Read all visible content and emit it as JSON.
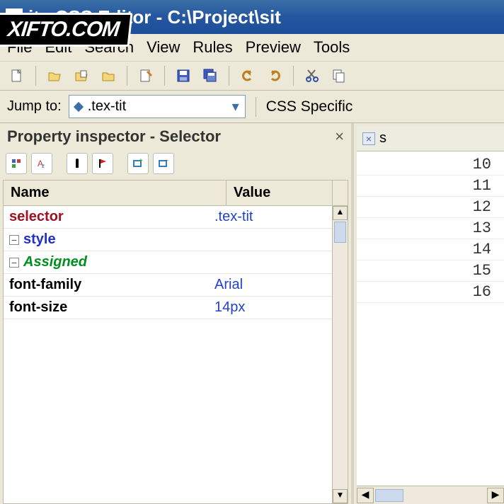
{
  "watermark": "XIFTO.COM",
  "window": {
    "title": "ite CSS Editor - C:\\Project\\sit"
  },
  "menu": {
    "items": [
      "File",
      "Edit",
      "Search",
      "View",
      "Rules",
      "Preview",
      "Tools"
    ]
  },
  "jump": {
    "label": "Jump to:",
    "value": ".tex-tit",
    "spec_label": "CSS Specific"
  },
  "inspector": {
    "title": "Property inspector - Selector",
    "columns": {
      "name": "Name",
      "value": "Value"
    },
    "rows": {
      "selector": {
        "label": "selector",
        "value": ".tex-tit"
      },
      "style": {
        "label": "style"
      },
      "assigned": {
        "label": "Assigned"
      },
      "font_family": {
        "label": "font-family",
        "value": "Arial"
      },
      "font_size": {
        "label": "font-size",
        "value": "14px"
      }
    }
  },
  "code": {
    "tab_label": "s",
    "lines": [
      "10",
      "11",
      "12",
      "13",
      "14",
      "15",
      "16"
    ]
  }
}
